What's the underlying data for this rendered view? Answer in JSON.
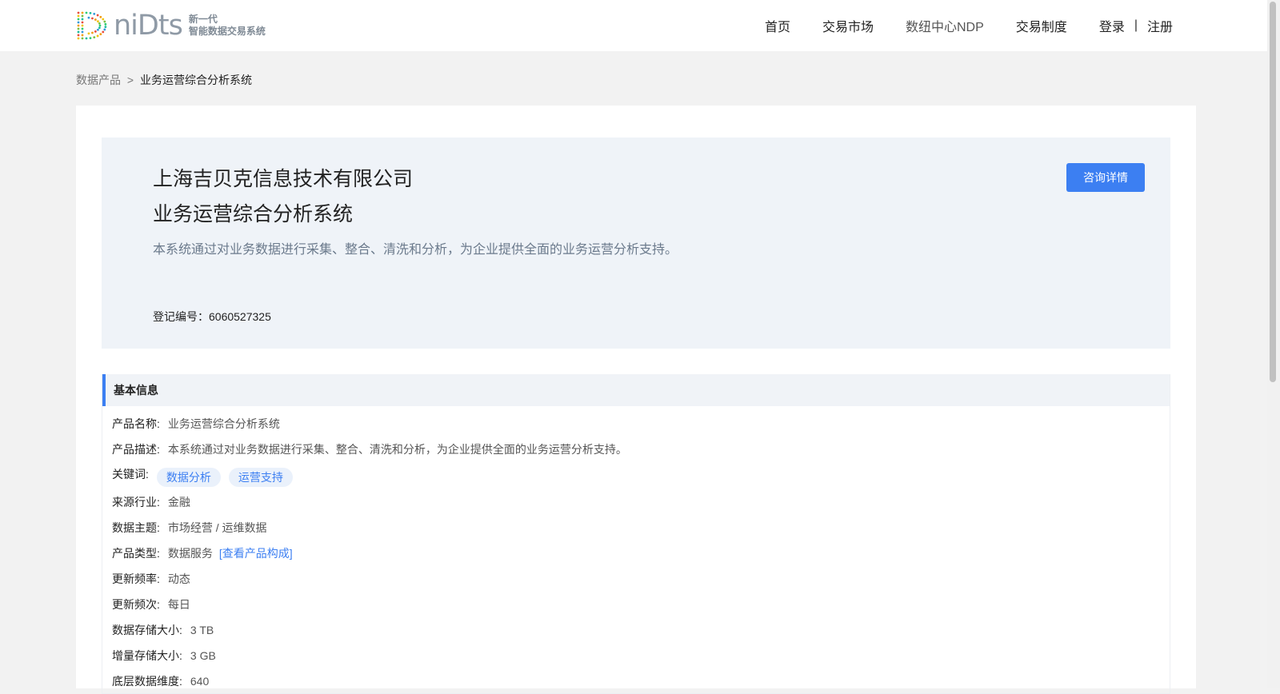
{
  "header": {
    "logo_text": "niDts",
    "logo_sub_line1": "新一代",
    "logo_sub_line2": "智能数据交易系统",
    "nav": [
      {
        "label": "首页"
      },
      {
        "label": "交易市场"
      },
      {
        "label": "数纽中心NDP"
      },
      {
        "label": "交易制度"
      }
    ],
    "login_label": "登录",
    "auth_separator": "|",
    "register_label": "注册"
  },
  "breadcrumb": {
    "parent": "数据产品",
    "separator": ">",
    "current": "业务运营综合分析系统"
  },
  "hero": {
    "company": "上海吉贝克信息技术有限公司",
    "product": "业务运营综合分析系统",
    "description": "本系统通过对业务数据进行采集、整合、清洗和分析，为企业提供全面的业务运营分析支持。",
    "registration": "登记编号：6060527325",
    "consult_button": "咨询详情"
  },
  "basic_info": {
    "title": "基本信息",
    "product_name": {
      "label": "产品名称:",
      "value": "业务运营综合分析系统"
    },
    "product_desc": {
      "label": "产品描述:",
      "value": "本系统通过对业务数据进行采集、整合、清洗和分析，为企业提供全面的业务运营分析支持。"
    },
    "keywords": {
      "label": "关键词:",
      "tags": [
        "数据分析",
        "运营支持"
      ]
    },
    "industry": {
      "label": "来源行业:",
      "value": "金融"
    },
    "topic": {
      "label": "数据主题:",
      "value": "市场经营 / 运维数据"
    },
    "product_type": {
      "label": "产品类型:",
      "value": "数据服务",
      "link": "[查看产品构成]"
    },
    "update_rate": {
      "label": "更新频率:",
      "value": "动态"
    },
    "update_freq": {
      "label": "更新频次:",
      "value": "每日"
    },
    "storage_size": {
      "label": "数据存储大小:",
      "value": "3 TB"
    },
    "incremental_size": {
      "label": "增量存储大小:",
      "value": "3 GB"
    },
    "dimensions": {
      "label": "底层数据维度:",
      "value": "640"
    }
  },
  "colors": {
    "accent": "#3c7ff2",
    "hero_bg": "#eff3f8",
    "page_bg": "#f2f2f2"
  }
}
